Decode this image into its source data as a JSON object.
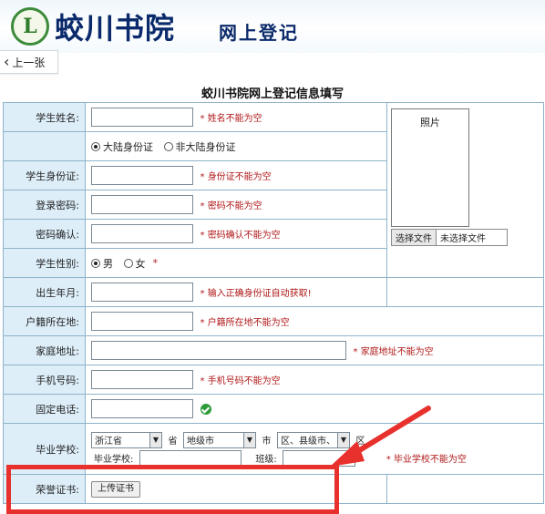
{
  "header": {
    "title": "蛟川书院",
    "subtitle": "网上登记",
    "logo_glyph": "L"
  },
  "nav": {
    "back_label": "上一张"
  },
  "form": {
    "title": "蛟川书院网上登记信息填写",
    "name_label": "学生姓名:",
    "name_error": "姓名不能为空",
    "id_type_mainland": "大陆身份证",
    "id_type_other": "非大陆身份证",
    "id_label": "学生身份证:",
    "id_error": "身份证不能为空",
    "password_label": "登录密码:",
    "password_error": "密码不能为空",
    "confirm_label": "密码确认:",
    "confirm_error": "密码确认不能为空",
    "gender_label": "学生性别:",
    "gender_male": "男",
    "gender_female": "女",
    "birth_label": "出生年月:",
    "birth_error": "输入正确身份证自动获取!",
    "hukou_label": "户籍所在地:",
    "hukou_error": "户籍所在地不能为空",
    "address_label": "家庭地址:",
    "address_error": "家庭地址不能为空",
    "mobile_label": "手机号码:",
    "mobile_error": "手机号码不能为空",
    "phone_label": "固定电话:",
    "school_label": "毕业学校:",
    "province_value": "浙江省",
    "province_suffix": "省",
    "city_value": "地级市",
    "city_suffix": "市",
    "district_value": "区、县级市、",
    "district_suffix": "区",
    "school_name_label": "毕业学校:",
    "class_label": "班级:",
    "school_error": "毕业学校不能为空",
    "honor_label": "荣誉证书:",
    "upload_label": "上传证书",
    "required_mark": "*"
  },
  "photo": {
    "label": "照片",
    "choose_file": "选择文件",
    "no_file": "未选择文件"
  },
  "colors": {
    "label_bg": "#ddeef9",
    "border": "#8fb3c9",
    "error": "#b01818",
    "highlight": "#e8302c"
  }
}
